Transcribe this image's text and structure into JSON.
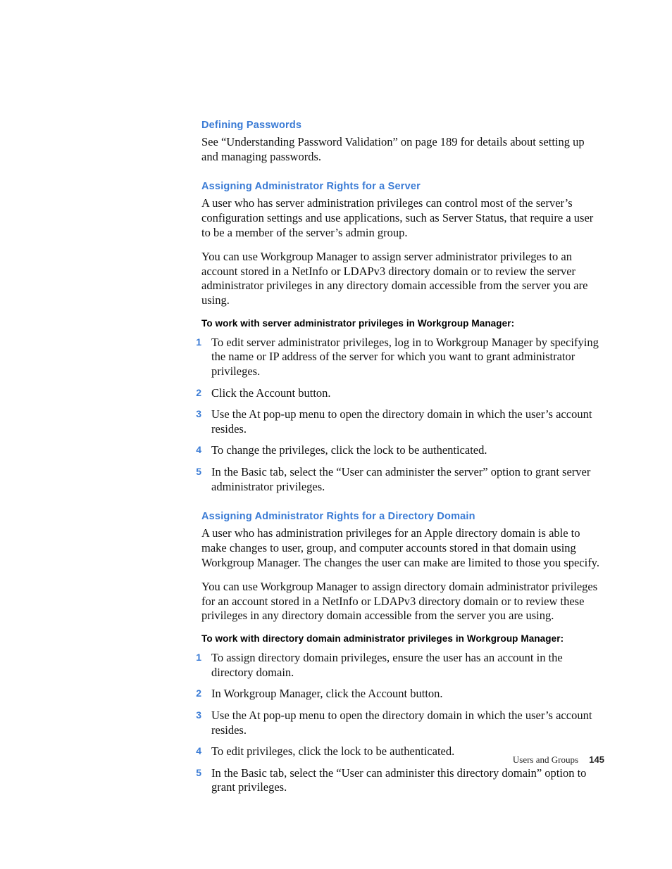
{
  "sections": [
    {
      "heading": "Defining Passwords",
      "paras": [
        "See “Understanding Password Validation” on page 189 for details about setting up and managing passwords."
      ]
    },
    {
      "heading": "Assigning Administrator Rights for a Server",
      "paras": [
        "A user who has server administration privileges can control most of the server’s configuration settings and use applications, such as Server Status, that require a user to be a member of the server’s admin group.",
        "You can use Workgroup Manager to assign server administrator privileges to an account stored in a NetInfo or LDAPv3 directory domain or to review the server administrator privileges in any directory domain accessible from the server you are using."
      ],
      "procHeading": "To work with server administrator privileges in Workgroup Manager:",
      "steps": [
        "To edit server administrator privileges, log in to Workgroup Manager by specifying the name or IP address of the server for which you want to grant administrator privileges.",
        "Click the Account button.",
        "Use the At pop-up menu to open the directory domain in which the user’s account resides.",
        "To change the privileges, click the lock to be authenticated.",
        "In the Basic tab, select the “User can administer the server” option to grant server administrator privileges."
      ]
    },
    {
      "heading": "Assigning Administrator Rights for a Directory Domain",
      "paras": [
        "A user who has administration privileges for an Apple directory domain is able to make changes to user, group, and computer accounts stored in that domain using Workgroup Manager. The changes the user can make are limited to those you specify.",
        "You can use Workgroup Manager to assign directory domain administrator privileges for an account stored in a NetInfo or LDAPv3 directory domain or to review these privileges in any directory domain accessible from the server you are using."
      ],
      "procHeading": "To work with directory domain administrator privileges in Workgroup Manager:",
      "steps": [
        "To assign directory domain privileges, ensure the user has an account in the directory domain.",
        "In Workgroup Manager, click the Account button.",
        "Use the At pop-up menu to open the directory domain in which the user’s account resides.",
        "To edit privileges, click the lock to be authenticated.",
        "In the Basic tab, select the “User can administer this directory domain” option to grant privileges."
      ]
    }
  ],
  "footer": {
    "chapter": "Users and Groups",
    "page": "145"
  }
}
